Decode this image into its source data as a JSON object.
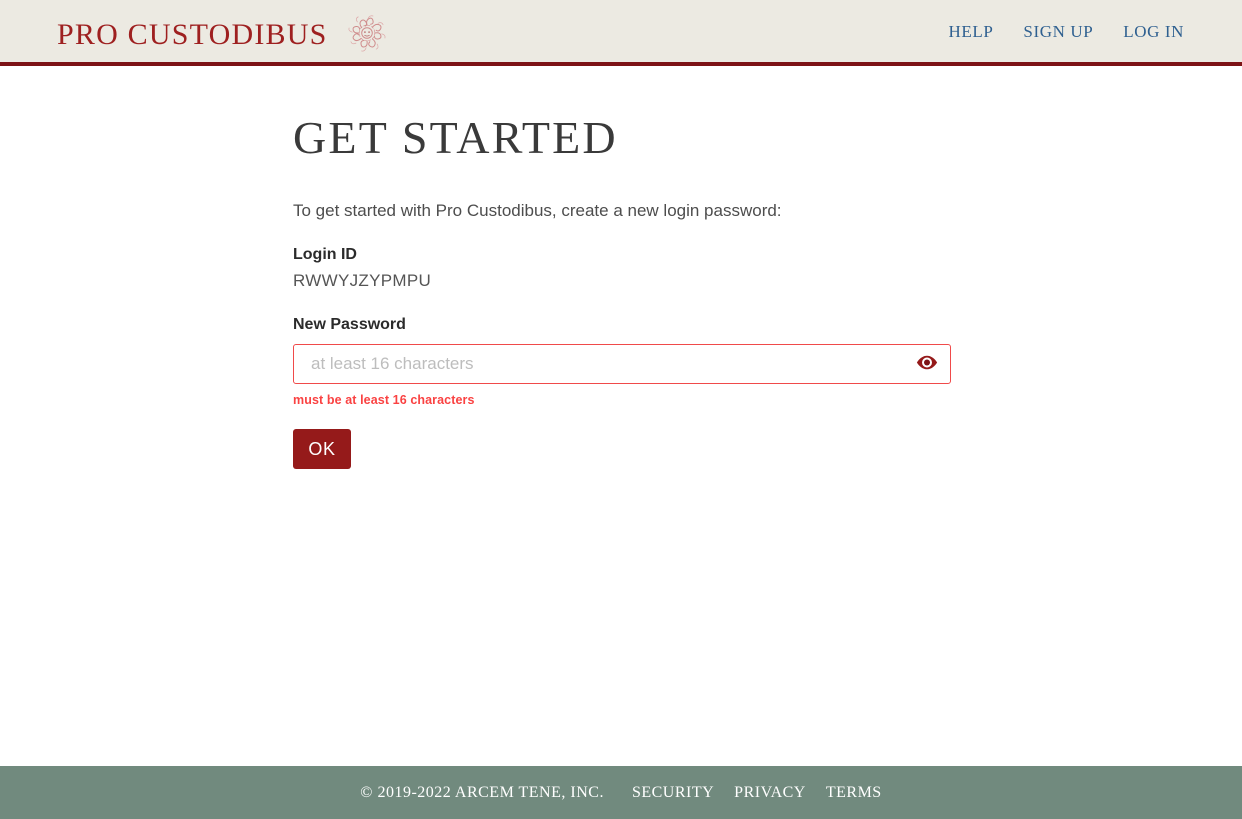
{
  "header": {
    "brand_name": "PRO CUSTODIBUS",
    "brand_emblem_icon": "medusa-emblem-icon",
    "brand_color": "#9e2020",
    "background_color": "#eceae2",
    "rule_color": "#7d1316",
    "nav": [
      {
        "label": "HELP"
      },
      {
        "label": "SIGN UP"
      },
      {
        "label": "LOG IN"
      }
    ],
    "nav_color": "#2f6090"
  },
  "main": {
    "title": "GET STARTED",
    "intro": "To get started with Pro Custodibus, create a new login password:",
    "login_id": {
      "label": "Login ID",
      "value": "RWWYJZYPMPU"
    },
    "password": {
      "label": "New Password",
      "value": "",
      "placeholder": "at least 16 characters",
      "error": "must be at least 16 characters",
      "error_color": "#fa4242",
      "border_color": "#f04a4a",
      "toggle_icon": "eye-icon",
      "toggle_icon_color": "#951a1a"
    },
    "submit_label": "OK",
    "submit_color": "#951a1a"
  },
  "footer": {
    "copyright": "© 2019-2022 ARCEM TENE, INC.",
    "background_color": "#718a7e",
    "links": [
      {
        "label": "SECURITY"
      },
      {
        "label": "PRIVACY"
      },
      {
        "label": "TERMS"
      }
    ]
  }
}
